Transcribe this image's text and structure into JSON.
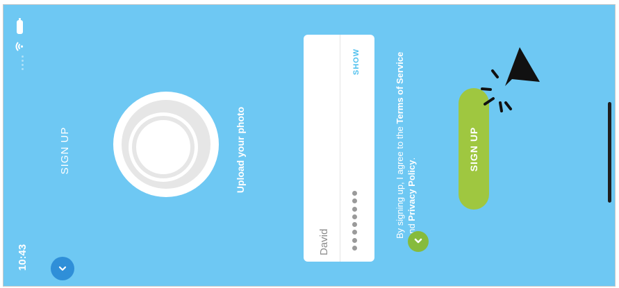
{
  "status_bar": {
    "time": "10:43"
  },
  "header": {
    "title": "SIGN UP"
  },
  "photo": {
    "upload_label": "Upload your photo"
  },
  "form": {
    "username_value": "David",
    "password_mask": "●●●●●●●●",
    "show_label": "SHOW"
  },
  "terms": {
    "prefix": "By signing up, I agree to the ",
    "terms_link": "Terms of Service",
    "and": " and ",
    "privacy_link": "Privacy Policy",
    "suffix": "."
  },
  "signup_button": {
    "label": "SIGN UP"
  },
  "colors": {
    "background": "#6ec8f3",
    "accent_green": "#9fc740",
    "check_green": "#86bb3c",
    "back_button_blue": "#2f8fd8",
    "show_link": "#4fc0ee"
  },
  "icons": {
    "back": "chevron-down-icon",
    "check": "check-icon",
    "battery": "battery-icon",
    "wifi": "wifi-icon",
    "cursor": "pointer-cursor-icon"
  }
}
